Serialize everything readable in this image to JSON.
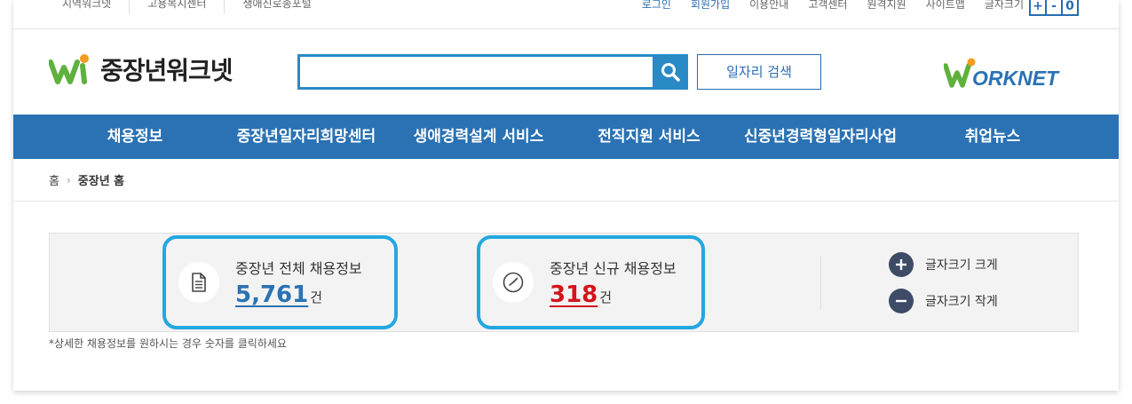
{
  "utility_left": [
    "지역워크넷",
    "고용복지센터",
    "생애진로종포털"
  ],
  "utility_right": [
    {
      "label": "로그인",
      "highlight": true
    },
    {
      "label": "회원가입",
      "highlight": true
    },
    {
      "label": "이용안내",
      "highlight": false
    },
    {
      "label": "고객센터",
      "highlight": false
    },
    {
      "label": "원격지원",
      "highlight": false
    },
    {
      "label": "사이트맵",
      "highlight": false
    },
    {
      "label": "글자크기",
      "highlight": false
    }
  ],
  "font_size_buttons": [
    "+",
    "-",
    "0"
  ],
  "logo": {
    "text": "중장년워크넷"
  },
  "search": {
    "placeholder": "",
    "button_label": "일자리 검색"
  },
  "worknet_logo": {
    "text": "ORKNET"
  },
  "nav": [
    "채용정보",
    "중장년일자리희망센터",
    "생애경력설계 서비스",
    "전직지원 서비스",
    "신중년경력형일자리사업",
    "취업뉴스"
  ],
  "breadcrumb": {
    "home": "홈",
    "current": "중장년 홈"
  },
  "stats": {
    "total": {
      "label": "중장년 전체 채용정보",
      "value": "5,761",
      "unit": "건"
    },
    "new": {
      "label": "중장년 신규 채용정보",
      "value": "318",
      "unit": "건"
    }
  },
  "font_controls": {
    "larger": "글자크기 크게",
    "smaller": "글자크기 작게"
  },
  "note": "*상세한 채용정보를 원하시는 경우 숫자를 클릭하세요",
  "colors": {
    "primary": "#2a72b4",
    "accent": "#23a7e0",
    "red": "#d4141d",
    "green": "#5fb13d",
    "orange": "#f39c1f"
  }
}
